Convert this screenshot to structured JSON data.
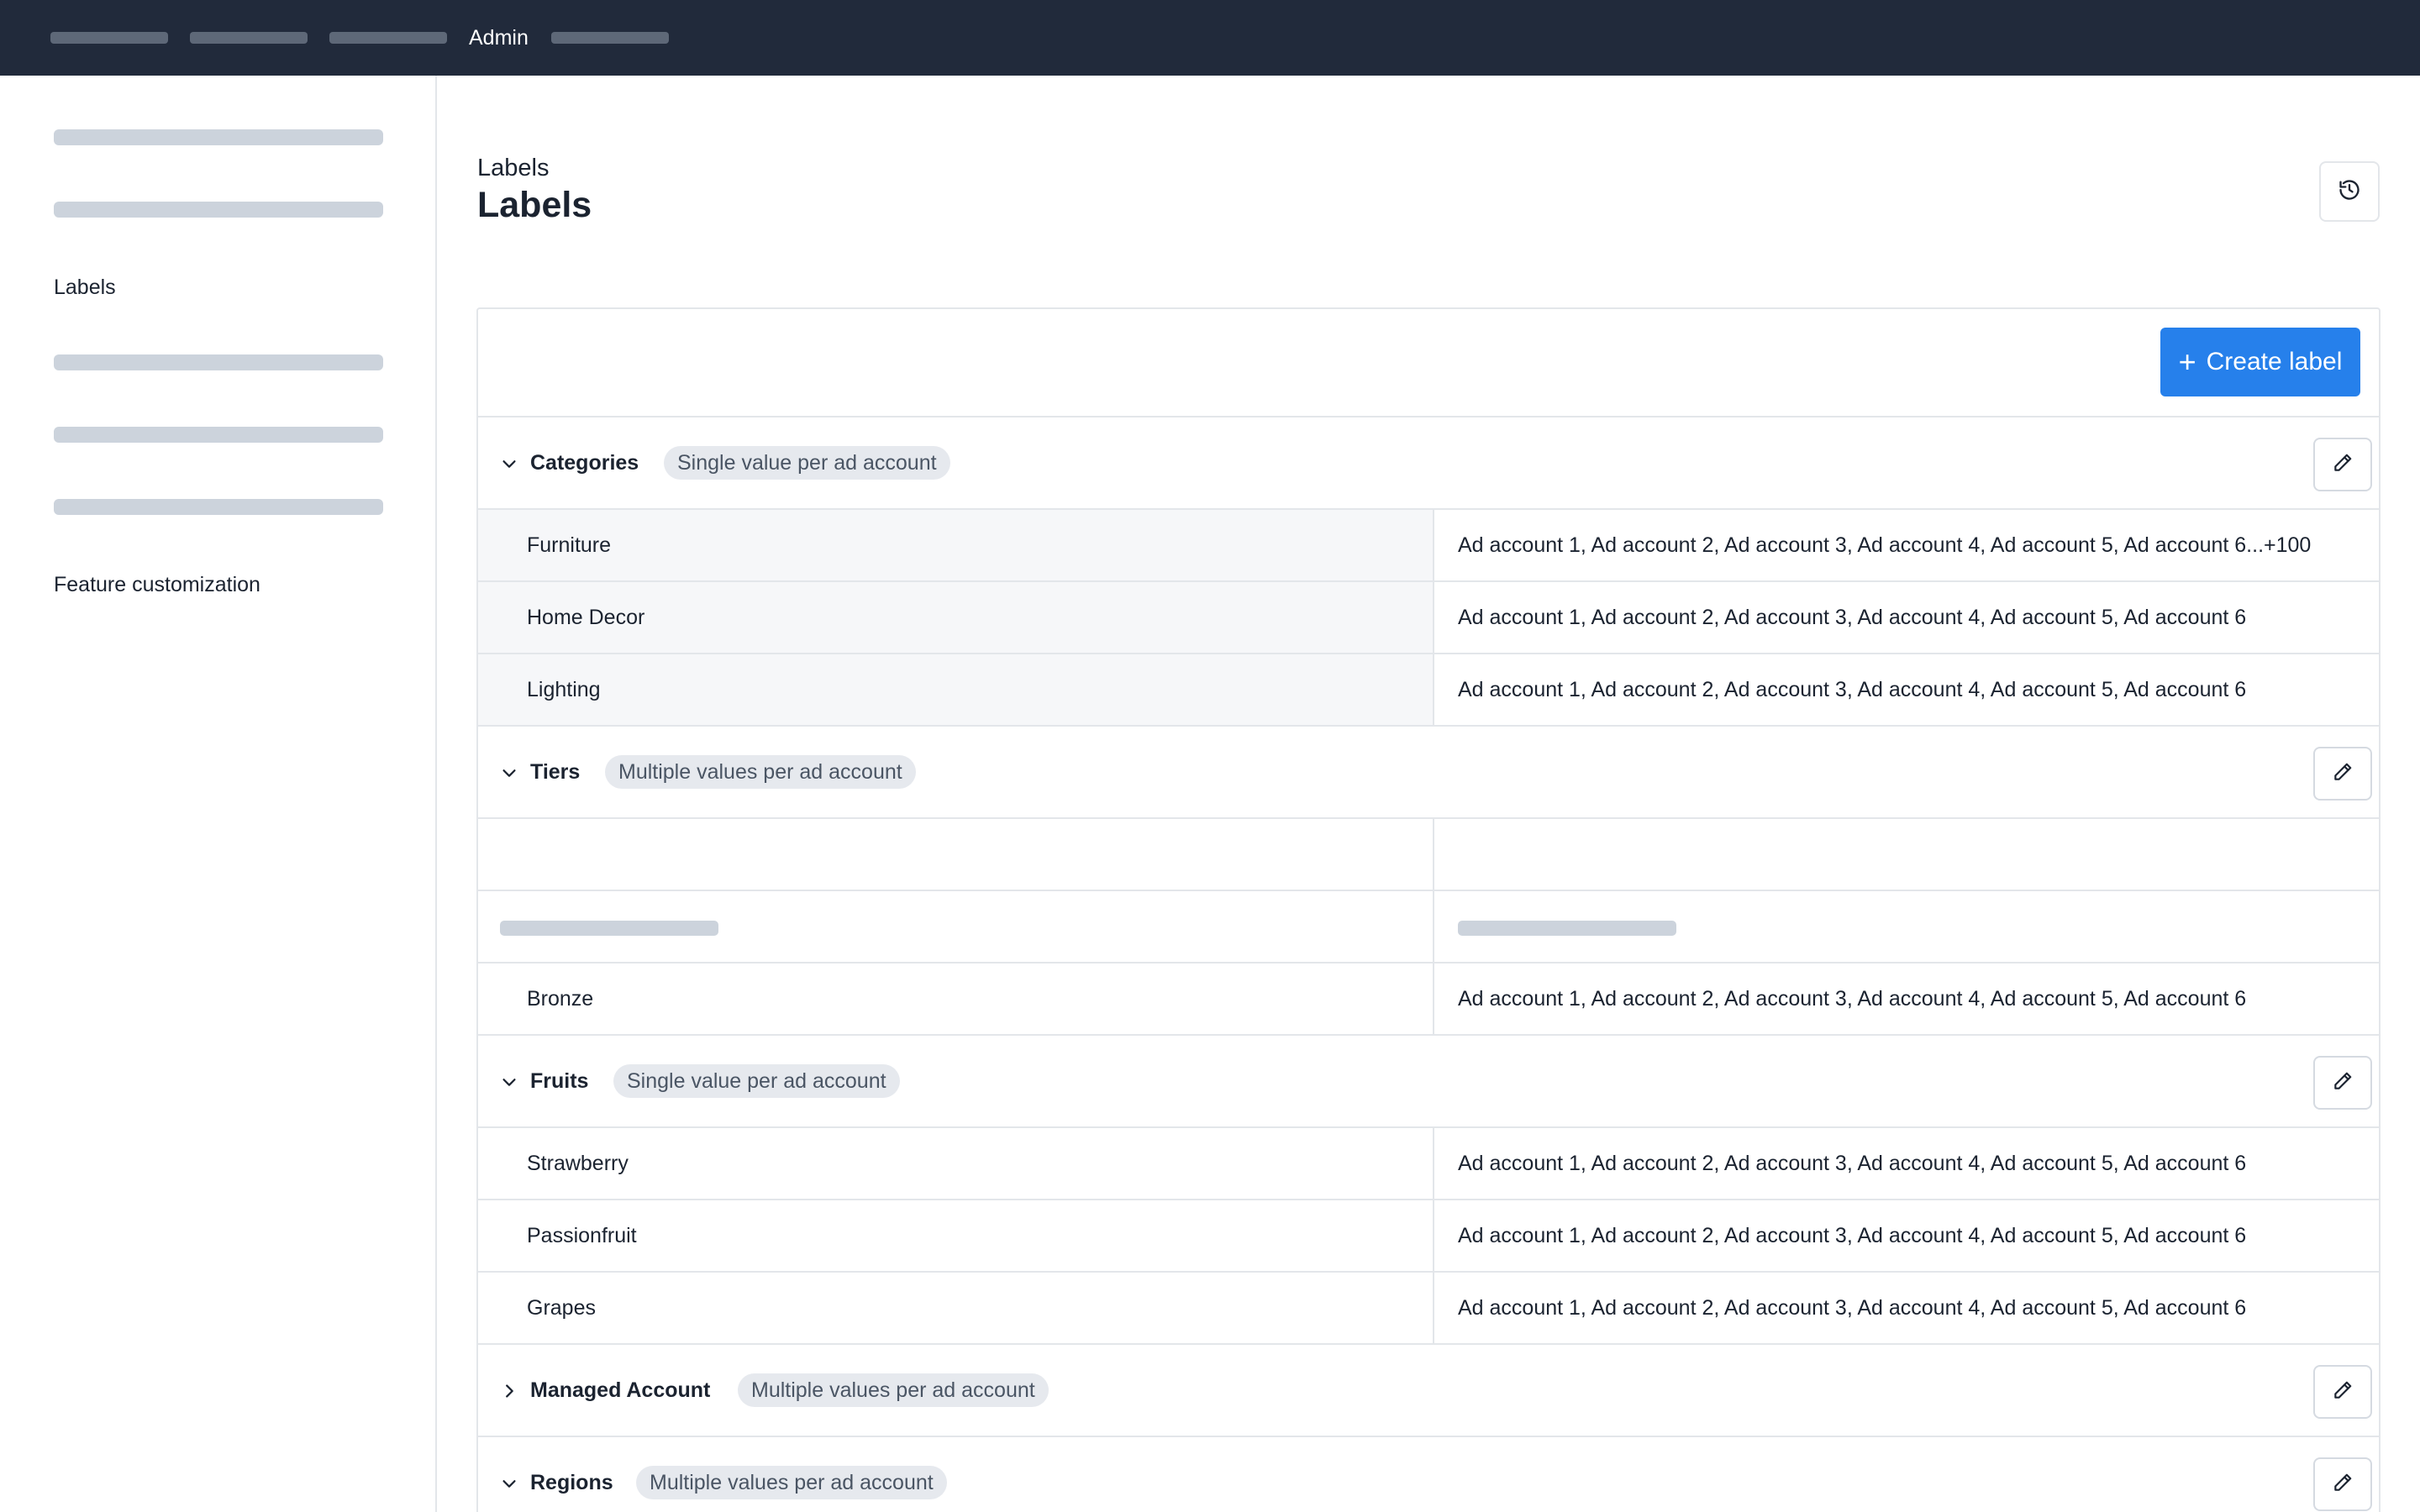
{
  "topbar": {
    "admin_label": "Admin"
  },
  "sidebar": {
    "items": [
      {
        "label": "Labels"
      },
      {
        "label": "Feature customization"
      }
    ]
  },
  "header": {
    "breadcrumb": "Labels",
    "title": "Labels",
    "history_icon": "history-icon"
  },
  "toolbar": {
    "create_label": "Create label",
    "create_icon": "+"
  },
  "groups": [
    {
      "name": "Categories",
      "badge": "Single value per ad account",
      "expanded": true,
      "rows": [
        {
          "value": "Furniture",
          "accounts": "Ad account 1, Ad account 2, Ad account 3, Ad account 4, Ad account 5, Ad account 6...+100"
        },
        {
          "value": "Home Decor",
          "accounts": "Ad account 1, Ad account 2, Ad account 3, Ad account 4, Ad account 5, Ad account 6"
        },
        {
          "value": "Lighting",
          "accounts": "Ad account 1, Ad account 2, Ad account 3, Ad account 4, Ad account 5, Ad account 6"
        }
      ]
    },
    {
      "name": "Tiers",
      "badge": "Multiple values per ad account",
      "expanded": true,
      "rows": [
        {
          "value": "Bronze",
          "accounts": "Ad account 1, Ad account 2, Ad account 3, Ad account 4, Ad account 5, Ad account 6"
        }
      ]
    },
    {
      "name": "Fruits",
      "badge": "Single value per ad account",
      "expanded": true,
      "rows": [
        {
          "value": "Strawberry",
          "accounts": "Ad account 1, Ad account 2, Ad account 3, Ad account 4, Ad account 5, Ad account 6"
        },
        {
          "value": "Passionfruit",
          "accounts": "Ad account 1, Ad account 2, Ad account 3, Ad account 4, Ad account 5, Ad account 6"
        },
        {
          "value": "Grapes",
          "accounts": "Ad account 1, Ad account 2, Ad account 3, Ad account 4, Ad account 5, Ad account 6"
        }
      ]
    },
    {
      "name": "Managed Account",
      "badge": "Multiple values per ad account",
      "expanded": false
    },
    {
      "name": "Regions",
      "badge": "Multiple values per ad account",
      "expanded": true
    }
  ],
  "colors": {
    "topbar_bg": "#212a3b",
    "primary": "#2680eb",
    "badge_bg": "#e6e9ee",
    "placeholder": "#ccd3dc"
  }
}
